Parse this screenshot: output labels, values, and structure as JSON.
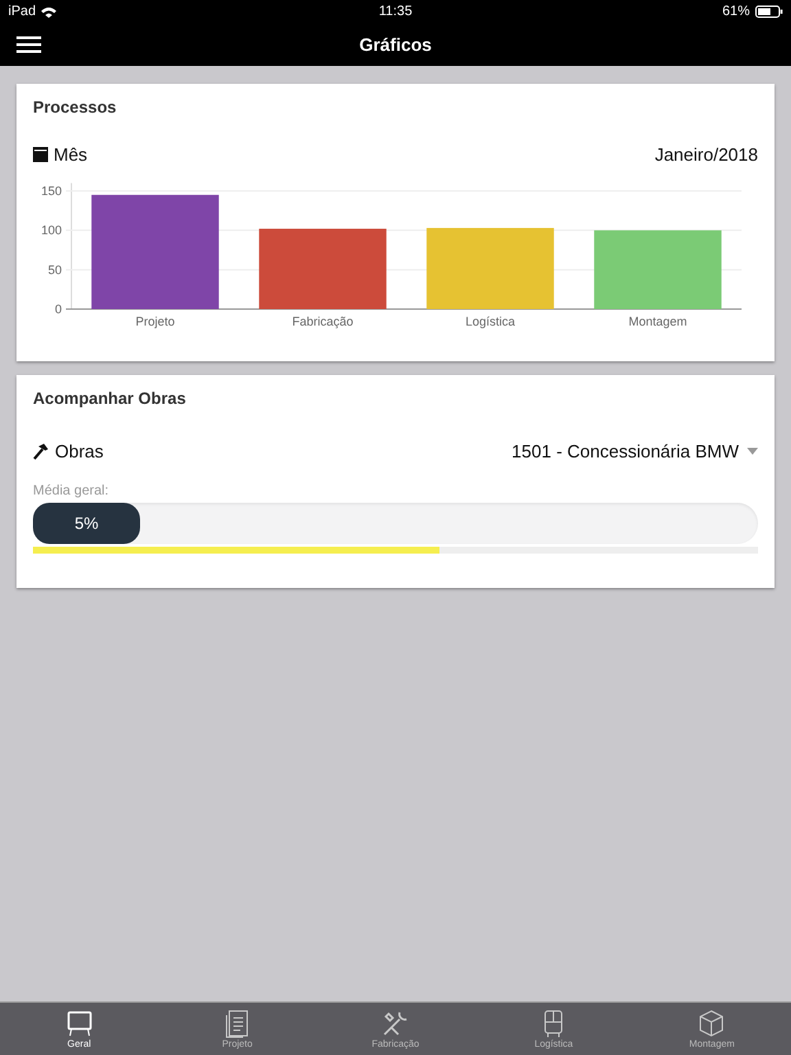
{
  "status_bar": {
    "device": "iPad",
    "time": "11:35",
    "battery": "61%"
  },
  "nav_bar": {
    "title": "Gráficos"
  },
  "processos": {
    "title": "Processos",
    "filter_label": "Mês",
    "filter_value": "Janeiro/2018",
    "chart_data": {
      "type": "bar",
      "categories": [
        "Projeto",
        "Fabricação",
        "Logística",
        "Montagem"
      ],
      "ylim": [
        0,
        160
      ],
      "yticks": [
        0,
        50,
        100,
        150
      ],
      "values": [
        145,
        102,
        103,
        100
      ],
      "grid": true,
      "colors": [
        "#7f45a8",
        "#cc4b3b",
        "#e6c232",
        "#7bcb75"
      ]
    }
  },
  "obras": {
    "title": "Acompanhar Obras",
    "filter_label": "Obras",
    "selected_value": "1501 - Concessionária BMW",
    "progress_label": "Média geral:",
    "progress_reading": "5%",
    "level": 0.56
  },
  "tabs": [
    {
      "label": "Geral",
      "selected": true,
      "kind": "board"
    },
    {
      "label": "Projeto",
      "selected": false,
      "kind": "doc"
    },
    {
      "label": "Fabricação",
      "selected": false,
      "kind": "tools"
    },
    {
      "label": "Logística",
      "selected": false,
      "kind": "bus"
    },
    {
      "label": "Montagem",
      "selected": false,
      "kind": "box"
    }
  ]
}
